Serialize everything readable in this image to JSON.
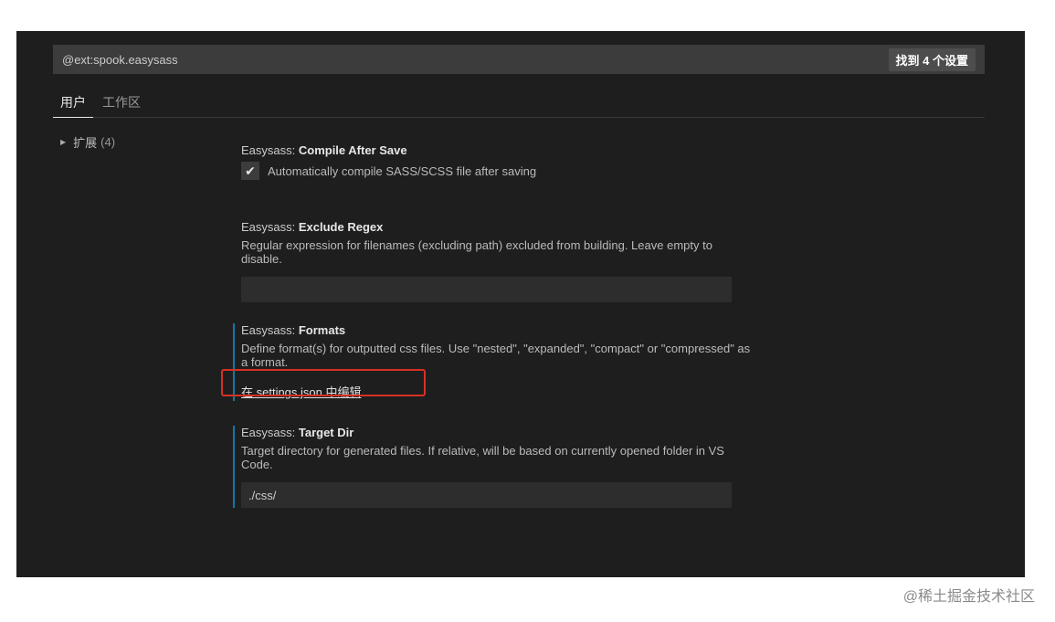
{
  "search": {
    "value": "@ext:spook.easysass",
    "result_count": "找到 4 个设置"
  },
  "tabs": [
    {
      "label": "用户",
      "active": true
    },
    {
      "label": "工作区",
      "active": false
    }
  ],
  "toc": {
    "label": "扩展",
    "count": "(4)"
  },
  "settings": [
    {
      "category": "Easysass: ",
      "name": "Compile After Save",
      "checkbox_label": "Automatically compile SASS/SCSS file after saving",
      "checked": true
    },
    {
      "category": "Easysass: ",
      "name": "Exclude Regex",
      "description": "Regular expression for filenames (excluding path) excluded from building. Leave empty to disable.",
      "value": ""
    },
    {
      "category": "Easysass: ",
      "name": "Formats",
      "description": "Define format(s) for outputted css files. Use \"nested\", \"expanded\", \"compact\" or \"compressed\" as a format.",
      "link": "在 settings.json 中编辑"
    },
    {
      "category": "Easysass: ",
      "name": "Target Dir",
      "description": "Target directory for generated files. If relative, will be based on currently opened folder in VS Code.",
      "value": "./css/"
    }
  ],
  "watermark": "@稀土掘金技术社区",
  "colors": {
    "background": "#1e1e1e",
    "input": "#3c3c3c",
    "modified_indicator": "#0e7aa5",
    "highlight": "#d93025"
  }
}
